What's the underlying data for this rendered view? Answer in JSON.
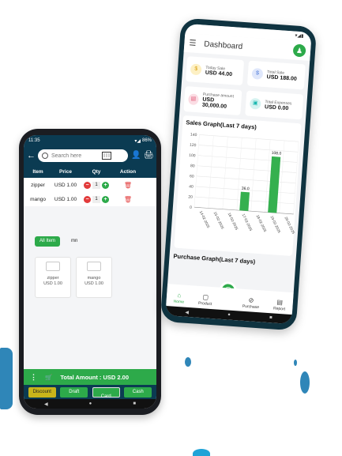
{
  "left_phone": {
    "status_time": "11:35",
    "status_right": "86%",
    "search": {
      "placeholder": "Search here"
    },
    "table": {
      "headers": [
        "Item",
        "Price",
        "Qty",
        "Action"
      ],
      "rows": [
        {
          "item": "zipper",
          "price": "USD 1.00",
          "qty": "1"
        },
        {
          "item": "mango",
          "price": "USD 1.00",
          "qty": "1"
        }
      ]
    },
    "filters": [
      "All Item",
      "mn"
    ],
    "products": [
      {
        "name": "zipper",
        "price": "USD 1.00"
      },
      {
        "name": "mango",
        "price": "USD 1.00"
      }
    ],
    "total": "Total Amount : USD 2.00",
    "pay_buttons": [
      "Discount",
      "Draft",
      "Card",
      "Cash"
    ]
  },
  "right_phone": {
    "header_title": "Dashboard",
    "stats": [
      {
        "label": "Today Sale",
        "value": "USD 44.00",
        "icon": "money-bag-icon",
        "color": "#f5c542"
      },
      {
        "label": "Total Sale",
        "value": "USD 188.00",
        "icon": "dollar-icon",
        "color": "#4a78d8"
      },
      {
        "label": "Purchase amount",
        "value": "USD 30,000.00",
        "icon": "cart-icon",
        "color": "#e3607d"
      },
      {
        "label": "Total Expenses",
        "value": "USD 0.00",
        "icon": "wallet-icon",
        "color": "#1bb8b0"
      }
    ],
    "sales_title": "Sales Graph(Last 7 days)",
    "purchase_title": "Purchase Graph(Last 7 days)",
    "bottom_nav": [
      "Home",
      "Product",
      "Purchase",
      "Report"
    ]
  },
  "chart_data": {
    "type": "bar",
    "title": "Sales Graph(Last 7 days)",
    "categories": [
      "14-02-2025",
      "15-02-2025",
      "16-02-2025",
      "17-02-2025",
      "18-02-2025",
      "19-02-2025",
      "20-02-2025"
    ],
    "values": [
      0,
      0,
      0,
      36,
      0,
      108,
      0
    ],
    "data_labels": [
      "",
      "",
      "",
      "36.0",
      "",
      "108.0",
      ""
    ],
    "yticks": [
      0,
      20,
      40,
      60,
      80,
      100,
      120,
      140
    ],
    "ylim": [
      0,
      140
    ],
    "bar_color": "#35b04f",
    "grid": true
  }
}
